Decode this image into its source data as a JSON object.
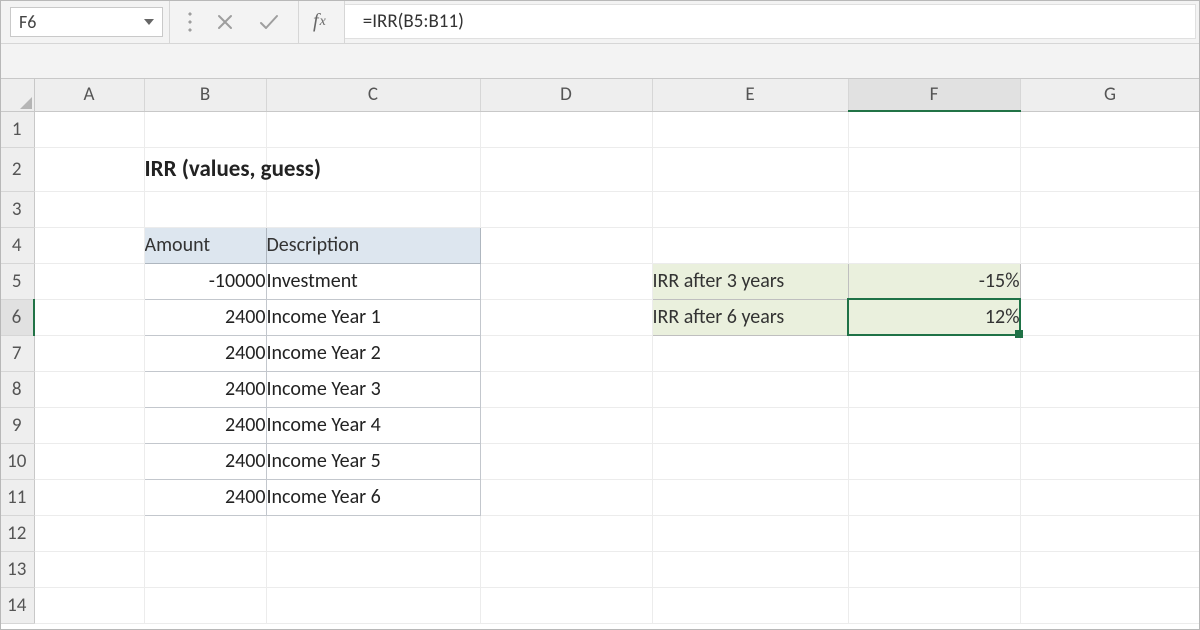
{
  "namebox": "F6",
  "formula": "=IRR(B5:B11)",
  "title": "IRR (values, guess)",
  "columns": [
    "A",
    "B",
    "C",
    "D",
    "E",
    "F",
    "G"
  ],
  "rows": [
    "1",
    "2",
    "3",
    "4",
    "5",
    "6",
    "7",
    "8",
    "9",
    "10",
    "11",
    "12",
    "13",
    "14"
  ],
  "table": {
    "head1": "Amount",
    "head2": "Description",
    "rows": [
      {
        "amount": "-10000",
        "desc": "Investment"
      },
      {
        "amount": "2400",
        "desc": "Income Year 1"
      },
      {
        "amount": "2400",
        "desc": "Income Year 2"
      },
      {
        "amount": "2400",
        "desc": "Income Year 3"
      },
      {
        "amount": "2400",
        "desc": "Income Year 4"
      },
      {
        "amount": "2400",
        "desc": "Income Year 5"
      },
      {
        "amount": "2400",
        "desc": "Income Year 6"
      }
    ]
  },
  "irr": {
    "r1_label": "IRR after 3 years",
    "r1_value": "-15%",
    "r2_label": "IRR after 6 years",
    "r2_value": "12%"
  },
  "activeCol": "F",
  "activeRow": "6"
}
